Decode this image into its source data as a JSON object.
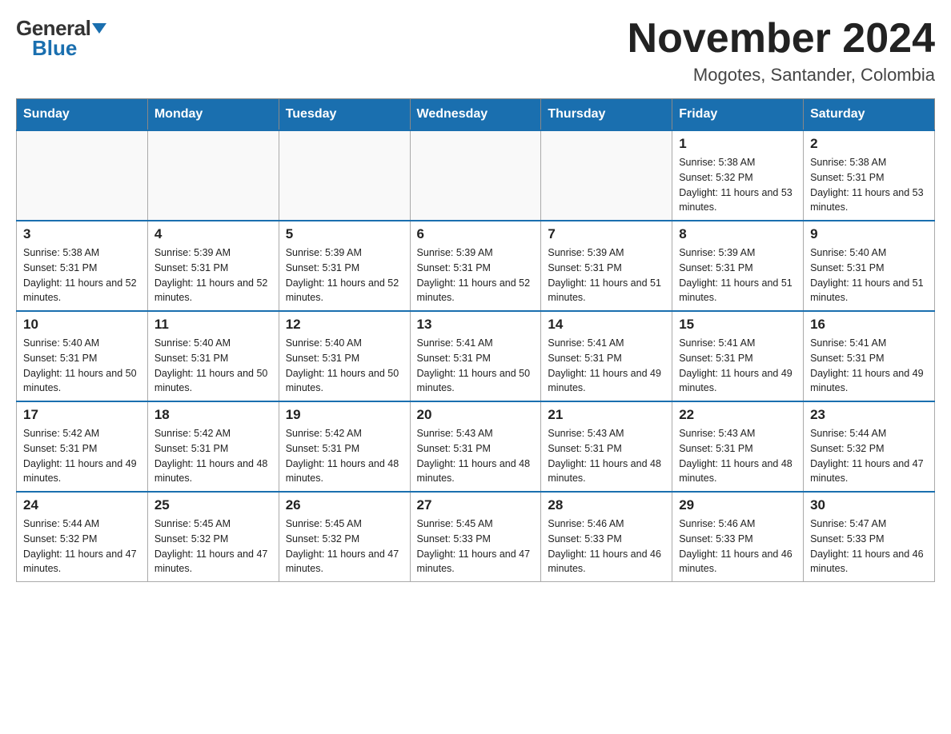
{
  "logo": {
    "general": "General",
    "blue": "Blue",
    "triangle": "▶"
  },
  "title": "November 2024",
  "subtitle": "Mogotes, Santander, Colombia",
  "days_of_week": [
    "Sunday",
    "Monday",
    "Tuesday",
    "Wednesday",
    "Thursday",
    "Friday",
    "Saturday"
  ],
  "weeks": [
    [
      {
        "day": "",
        "info": ""
      },
      {
        "day": "",
        "info": ""
      },
      {
        "day": "",
        "info": ""
      },
      {
        "day": "",
        "info": ""
      },
      {
        "day": "",
        "info": ""
      },
      {
        "day": "1",
        "info": "Sunrise: 5:38 AM\nSunset: 5:32 PM\nDaylight: 11 hours and 53 minutes."
      },
      {
        "day": "2",
        "info": "Sunrise: 5:38 AM\nSunset: 5:31 PM\nDaylight: 11 hours and 53 minutes."
      }
    ],
    [
      {
        "day": "3",
        "info": "Sunrise: 5:38 AM\nSunset: 5:31 PM\nDaylight: 11 hours and 52 minutes."
      },
      {
        "day": "4",
        "info": "Sunrise: 5:39 AM\nSunset: 5:31 PM\nDaylight: 11 hours and 52 minutes."
      },
      {
        "day": "5",
        "info": "Sunrise: 5:39 AM\nSunset: 5:31 PM\nDaylight: 11 hours and 52 minutes."
      },
      {
        "day": "6",
        "info": "Sunrise: 5:39 AM\nSunset: 5:31 PM\nDaylight: 11 hours and 52 minutes."
      },
      {
        "day": "7",
        "info": "Sunrise: 5:39 AM\nSunset: 5:31 PM\nDaylight: 11 hours and 51 minutes."
      },
      {
        "day": "8",
        "info": "Sunrise: 5:39 AM\nSunset: 5:31 PM\nDaylight: 11 hours and 51 minutes."
      },
      {
        "day": "9",
        "info": "Sunrise: 5:40 AM\nSunset: 5:31 PM\nDaylight: 11 hours and 51 minutes."
      }
    ],
    [
      {
        "day": "10",
        "info": "Sunrise: 5:40 AM\nSunset: 5:31 PM\nDaylight: 11 hours and 50 minutes."
      },
      {
        "day": "11",
        "info": "Sunrise: 5:40 AM\nSunset: 5:31 PM\nDaylight: 11 hours and 50 minutes."
      },
      {
        "day": "12",
        "info": "Sunrise: 5:40 AM\nSunset: 5:31 PM\nDaylight: 11 hours and 50 minutes."
      },
      {
        "day": "13",
        "info": "Sunrise: 5:41 AM\nSunset: 5:31 PM\nDaylight: 11 hours and 50 minutes."
      },
      {
        "day": "14",
        "info": "Sunrise: 5:41 AM\nSunset: 5:31 PM\nDaylight: 11 hours and 49 minutes."
      },
      {
        "day": "15",
        "info": "Sunrise: 5:41 AM\nSunset: 5:31 PM\nDaylight: 11 hours and 49 minutes."
      },
      {
        "day": "16",
        "info": "Sunrise: 5:41 AM\nSunset: 5:31 PM\nDaylight: 11 hours and 49 minutes."
      }
    ],
    [
      {
        "day": "17",
        "info": "Sunrise: 5:42 AM\nSunset: 5:31 PM\nDaylight: 11 hours and 49 minutes."
      },
      {
        "day": "18",
        "info": "Sunrise: 5:42 AM\nSunset: 5:31 PM\nDaylight: 11 hours and 48 minutes."
      },
      {
        "day": "19",
        "info": "Sunrise: 5:42 AM\nSunset: 5:31 PM\nDaylight: 11 hours and 48 minutes."
      },
      {
        "day": "20",
        "info": "Sunrise: 5:43 AM\nSunset: 5:31 PM\nDaylight: 11 hours and 48 minutes."
      },
      {
        "day": "21",
        "info": "Sunrise: 5:43 AM\nSunset: 5:31 PM\nDaylight: 11 hours and 48 minutes."
      },
      {
        "day": "22",
        "info": "Sunrise: 5:43 AM\nSunset: 5:31 PM\nDaylight: 11 hours and 48 minutes."
      },
      {
        "day": "23",
        "info": "Sunrise: 5:44 AM\nSunset: 5:32 PM\nDaylight: 11 hours and 47 minutes."
      }
    ],
    [
      {
        "day": "24",
        "info": "Sunrise: 5:44 AM\nSunset: 5:32 PM\nDaylight: 11 hours and 47 minutes."
      },
      {
        "day": "25",
        "info": "Sunrise: 5:45 AM\nSunset: 5:32 PM\nDaylight: 11 hours and 47 minutes."
      },
      {
        "day": "26",
        "info": "Sunrise: 5:45 AM\nSunset: 5:32 PM\nDaylight: 11 hours and 47 minutes."
      },
      {
        "day": "27",
        "info": "Sunrise: 5:45 AM\nSunset: 5:33 PM\nDaylight: 11 hours and 47 minutes."
      },
      {
        "day": "28",
        "info": "Sunrise: 5:46 AM\nSunset: 5:33 PM\nDaylight: 11 hours and 46 minutes."
      },
      {
        "day": "29",
        "info": "Sunrise: 5:46 AM\nSunset: 5:33 PM\nDaylight: 11 hours and 46 minutes."
      },
      {
        "day": "30",
        "info": "Sunrise: 5:47 AM\nSunset: 5:33 PM\nDaylight: 11 hours and 46 minutes."
      }
    ]
  ]
}
